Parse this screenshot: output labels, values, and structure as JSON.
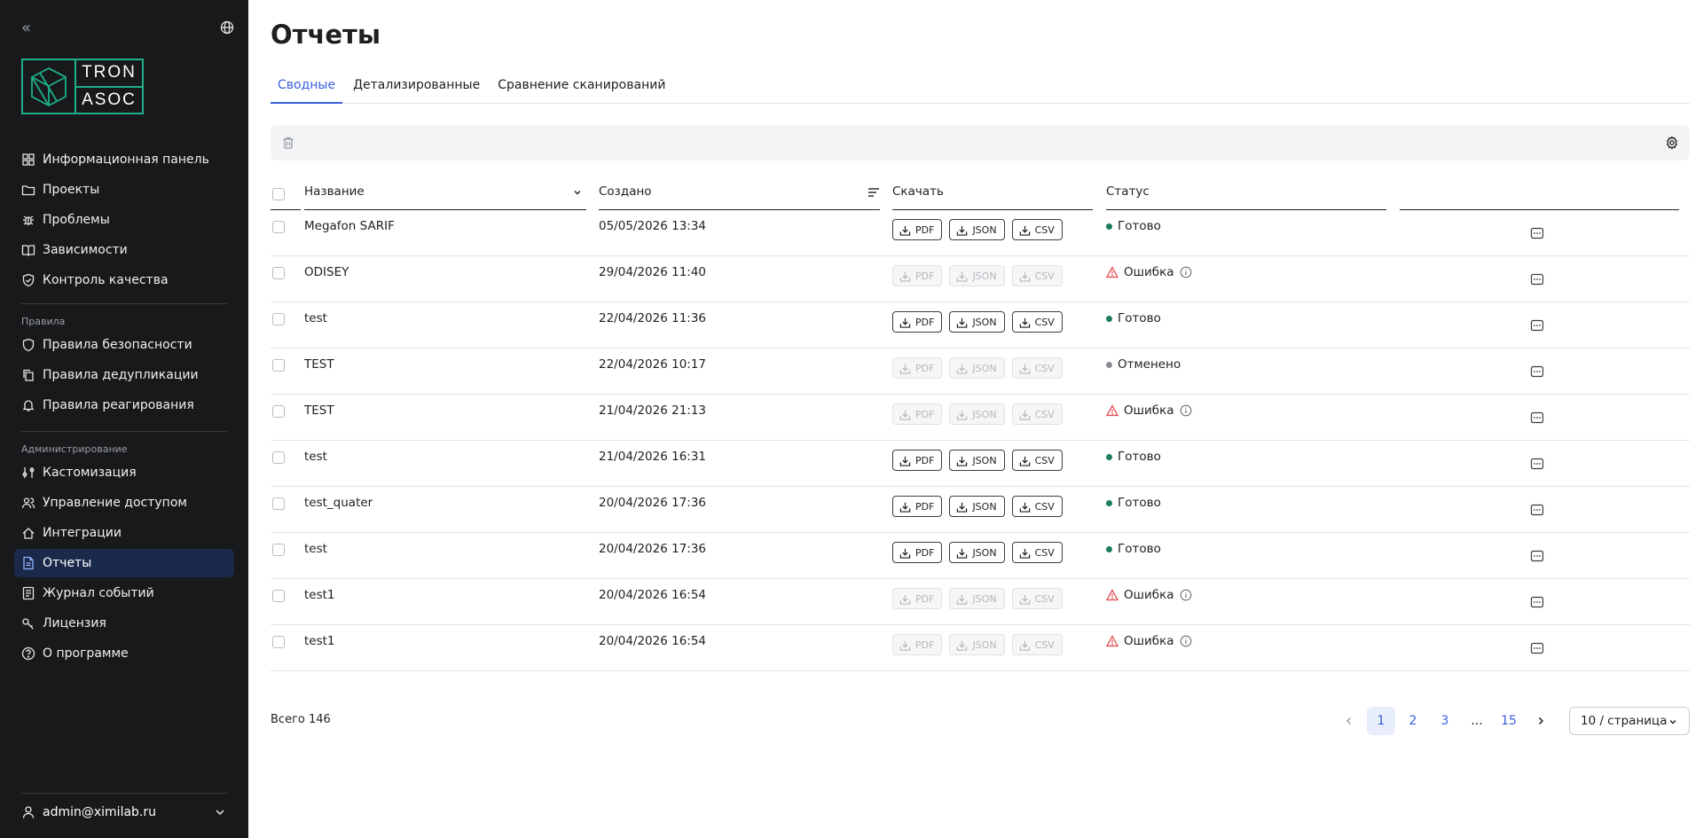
{
  "sidebar": {
    "logo_line1": "TRON",
    "logo_line2": "ASOC",
    "items_main": [
      {
        "label": "Информационная панель",
        "icon": "dashboard-icon"
      },
      {
        "label": "Проекты",
        "icon": "folder-icon"
      },
      {
        "label": "Проблемы",
        "icon": "bug-icon"
      },
      {
        "label": "Зависимости",
        "icon": "book-icon"
      },
      {
        "label": "Контроль качества",
        "icon": "shield-check-icon"
      }
    ],
    "section_rules": "Правила",
    "items_rules": [
      {
        "label": "Правила безопасности",
        "icon": "shield-icon"
      },
      {
        "label": "Правила дедупликации",
        "icon": "copy-icon"
      },
      {
        "label": "Правила реагирования",
        "icon": "bell-icon"
      }
    ],
    "section_admin": "Администрирование",
    "items_admin": [
      {
        "label": "Кастомизация",
        "icon": "sliders-icon"
      },
      {
        "label": "Управление доступом",
        "icon": "users-icon"
      },
      {
        "label": "Интеграции",
        "icon": "integration-icon"
      },
      {
        "label": "Отчеты",
        "icon": "report-icon"
      },
      {
        "label": "Журнал событий",
        "icon": "journal-icon"
      },
      {
        "label": "Лицензия",
        "icon": "key-icon"
      },
      {
        "label": "О программе",
        "icon": "help-icon"
      }
    ],
    "active_item": "Отчеты",
    "user": "admin@ximilab.ru"
  },
  "main": {
    "title": "Отчеты",
    "tabs": [
      "Сводные",
      "Детализированные",
      "Сравнение сканирований"
    ],
    "active_tab": "Сводные",
    "columns": {
      "name": "Название",
      "created": "Создано",
      "download": "Скачать",
      "status": "Статус"
    },
    "download_labels": [
      "PDF",
      "JSON",
      "CSV"
    ],
    "rows": [
      {
        "name": "Megafon SARIF",
        "created": "05/05/2026 13:34",
        "status": "Готово",
        "state": "ready"
      },
      {
        "name": "ODISEY",
        "created": "29/04/2026 11:40",
        "status": "Ошибка",
        "state": "error"
      },
      {
        "name": "test",
        "created": "22/04/2026 11:36",
        "status": "Готово",
        "state": "ready"
      },
      {
        "name": "TEST",
        "created": "22/04/2026 10:17",
        "status": "Отменено",
        "state": "cancelled"
      },
      {
        "name": "TEST",
        "created": "21/04/2026 21:13",
        "status": "Ошибка",
        "state": "error"
      },
      {
        "name": "test",
        "created": "21/04/2026 16:31",
        "status": "Готово",
        "state": "ready"
      },
      {
        "name": "test_quater",
        "created": "20/04/2026 17:36",
        "status": "Готово",
        "state": "ready"
      },
      {
        "name": "test",
        "created": "20/04/2026 17:36",
        "status": "Готово",
        "state": "ready"
      },
      {
        "name": "test1",
        "created": "20/04/2026 16:54",
        "status": "Ошибка",
        "state": "error"
      },
      {
        "name": "test1",
        "created": "20/04/2026 16:54",
        "status": "Ошибка",
        "state": "error"
      }
    ],
    "total": "Всего 146",
    "pages": [
      "1",
      "2",
      "3",
      "...",
      "15"
    ],
    "current_page": "1",
    "page_size": "10 / страница"
  },
  "colors": {
    "sidebar_bg": "#18191b",
    "accent": "#3a5fd9",
    "brand": "#1fae8a",
    "status_ready": "#1a7f5a",
    "status_error": "#e5484d",
    "status_cancelled": "#8a8d92"
  }
}
